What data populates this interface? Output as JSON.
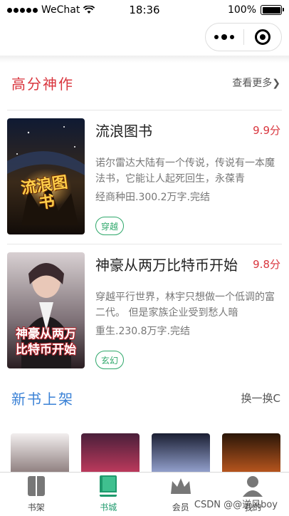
{
  "status_bar": {
    "carrier": "WeChat",
    "time": "18:36",
    "battery": "100%",
    "battery_level": 1.0
  },
  "high_score": {
    "title": "高分神作",
    "more": "查看更多❯",
    "books": [
      {
        "title": "流浪图书",
        "score": "9.9分",
        "intro": "诺尔雷达大陆有一个传说，传说有一本魔法书，它能让人起死回生，永葆青",
        "meta": "经商种田.300.2万字.完结",
        "tag": "穿越",
        "cover_text": "流浪图书",
        "cover_colors": [
          "#0f1a33",
          "#3a2a1a",
          "#c98a2e"
        ]
      },
      {
        "title": "神豪从两万比特币开始",
        "score": "9.8分",
        "intro": "穿越平行世界，林宇只想做一个低调的富二代。 但是家族企业受到愁人暗",
        "meta": "重生.230.8万字.完结",
        "tag": "玄幻",
        "cover_text": "神豪从两万比特币开始",
        "cover_colors": [
          "#c9c0c2",
          "#7c6f75",
          "#b2232b"
        ]
      }
    ]
  },
  "new_books": {
    "title": "新书上架",
    "refresh": "换一换C",
    "covers": [
      {
        "colors": [
          "#f2eeee",
          "#8a7a7a"
        ]
      },
      {
        "colors": [
          "#4a1f3a",
          "#c33b5e"
        ]
      },
      {
        "colors": [
          "#1b1f33",
          "#9aa8d6"
        ]
      },
      {
        "colors": [
          "#2a1608",
          "#c0591f"
        ]
      }
    ]
  },
  "tabbar": {
    "tabs": [
      {
        "label": "书架",
        "icon": "bookshelf-icon"
      },
      {
        "label": "书城",
        "icon": "bookstore-icon",
        "active": true
      },
      {
        "label": "会员",
        "icon": "crown-icon"
      },
      {
        "label": "我的",
        "icon": "user-icon"
      }
    ]
  },
  "watermark": "CSDN @@逆风boy"
}
